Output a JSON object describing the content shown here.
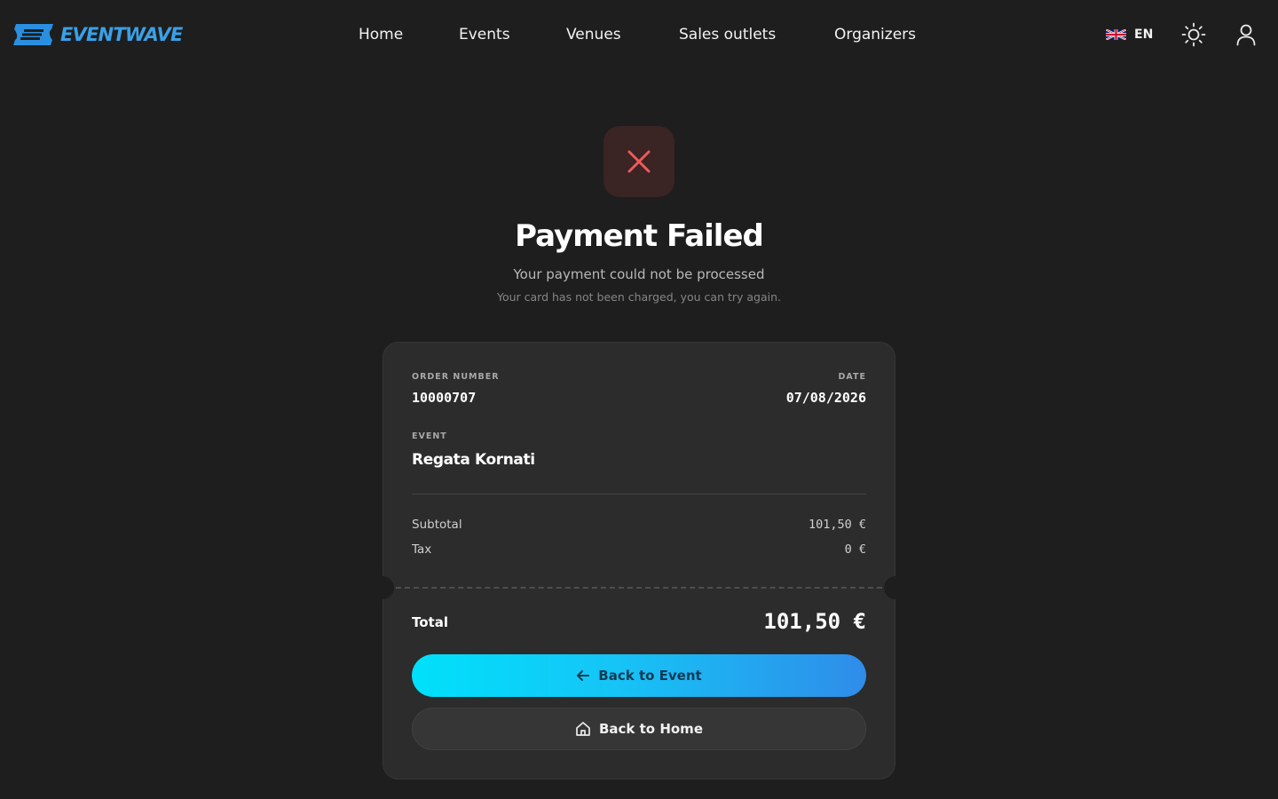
{
  "brand": {
    "name": "EVENTWAVE",
    "color": "#3aa0e8"
  },
  "nav": {
    "items": [
      {
        "label": "Home"
      },
      {
        "label": "Events"
      },
      {
        "label": "Venues"
      },
      {
        "label": "Sales outlets"
      },
      {
        "label": "Organizers"
      }
    ]
  },
  "header": {
    "language": {
      "flag_icon": "uk-flag-icon",
      "code": "EN"
    },
    "theme_toggle_icon": "sun-icon",
    "account_icon": "user-icon"
  },
  "status": {
    "icon": "close-icon",
    "accent_color": "#ef5a5a",
    "title": "Payment Failed",
    "subtitle": "Your payment could not be processed",
    "note": "Your card has not been charged, you can try again."
  },
  "order": {
    "order_number_label": "ORDER NUMBER",
    "order_number": "10000707",
    "date_label": "DATE",
    "date": "07/08/2026",
    "event_label": "EVENT",
    "event_name": "Regata Kornati",
    "subtotal_label": "Subtotal",
    "subtotal": "101,50 €",
    "tax_label": "Tax",
    "tax": "0 €",
    "total_label": "Total",
    "total": "101,50 €"
  },
  "actions": {
    "back_to_event": {
      "label": "Back to Event",
      "icon": "arrow-left-icon"
    },
    "back_to_home": {
      "label": "Back to Home",
      "icon": "home-icon"
    }
  }
}
